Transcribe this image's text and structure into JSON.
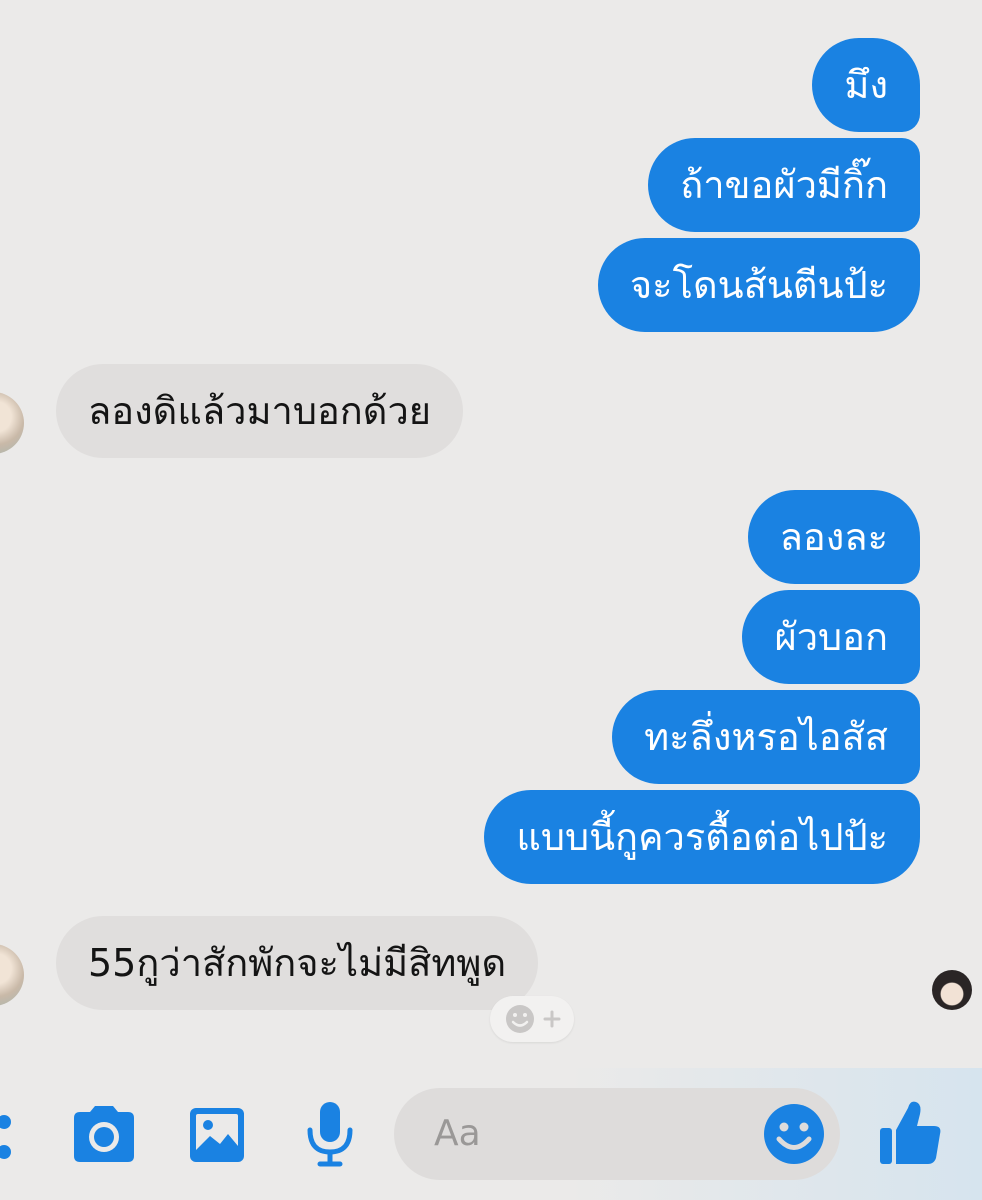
{
  "messages": [
    {
      "dir": "out",
      "text": "มึง"
    },
    {
      "dir": "out",
      "text": "ถ้าขอผัวมีกิ๊ก"
    },
    {
      "dir": "out",
      "text": "จะโดนส้นตีนป้ะ"
    },
    {
      "dir": "in",
      "text": "ลองดิแล้วมาบอกด้วย"
    },
    {
      "dir": "out",
      "text": "ลองละ"
    },
    {
      "dir": "out",
      "text": "ผัวบอก"
    },
    {
      "dir": "out",
      "text": "ทะลึ่งหรอไอสัส"
    },
    {
      "dir": "out",
      "text": "แบบนี้กูควรตื้อต่อไปป้ะ"
    },
    {
      "dir": "in",
      "text": "55กูว่าสักพักจะไม่มีสิทพูด"
    }
  ],
  "composer": {
    "placeholder": "Aa",
    "icons": [
      "more-dots-icon",
      "camera-icon",
      "gallery-icon",
      "microphone-icon",
      "emoji-icon",
      "thumbs-up-icon"
    ]
  },
  "colors": {
    "background": "#ebeae9",
    "outgoing_bubble": "#1a82e2",
    "incoming_bubble": "#e0dedd",
    "accent": "#1a82e2"
  }
}
